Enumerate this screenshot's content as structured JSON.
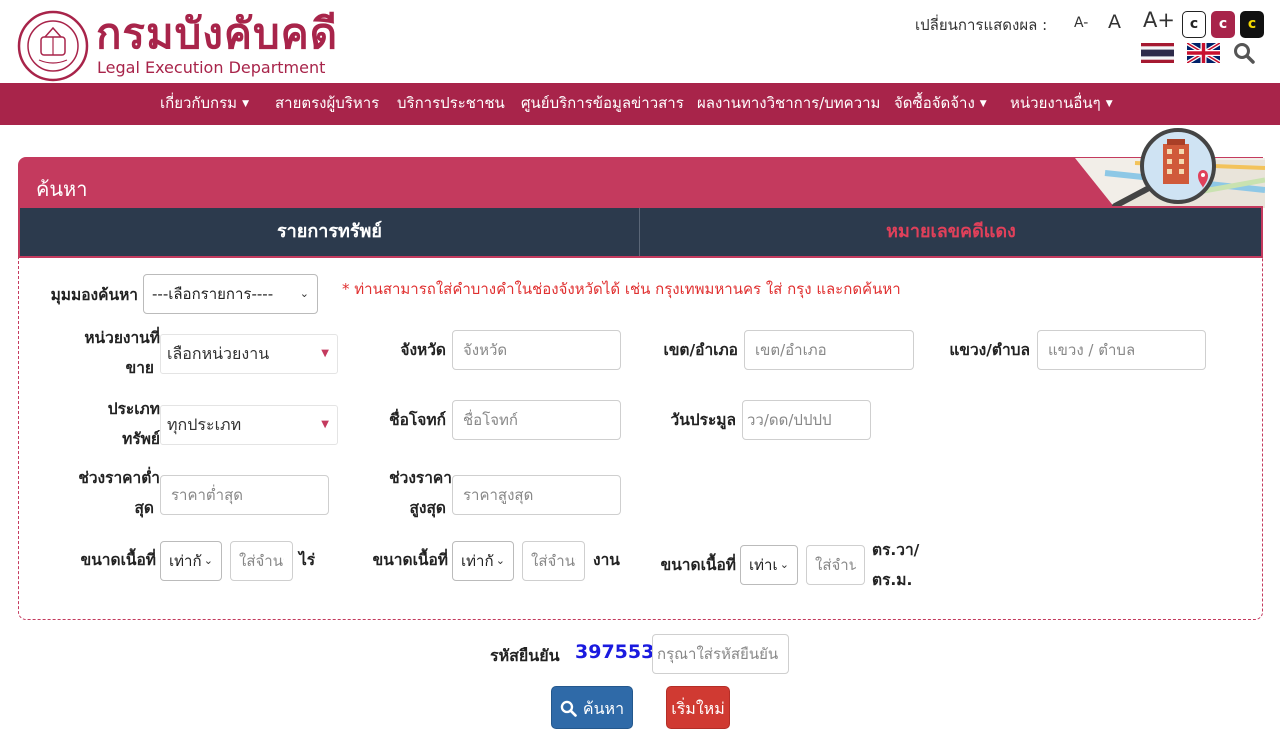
{
  "header": {
    "logo_th": "กรมบังคับคดี",
    "logo_en": "Legal Execution Department",
    "display_label": "เปลี่ยนการแสดงผล  :",
    "font_small": "A-",
    "font_normal": "A",
    "font_large": "A+",
    "contrast": [
      "c",
      "c",
      "c"
    ],
    "brand_color": "#a8244a"
  },
  "nav": {
    "items": [
      {
        "label": "เกี่ยวกับกรม",
        "dropdown": true
      },
      {
        "label": "สายตรงผู้บริหาร",
        "dropdown": false
      },
      {
        "label": "บริการประชาชน",
        "dropdown": false
      },
      {
        "label": "ศูนย์บริการข้อมูลข่าวสาร",
        "dropdown": false
      },
      {
        "label": "ผลงานทางวิชาการ/บทความ",
        "dropdown": false
      },
      {
        "label": "จัดซื้อจัดจ้าง",
        "dropdown": true
      },
      {
        "label": "หน่วยงานอื่นๆ",
        "dropdown": true
      }
    ]
  },
  "panel": {
    "title": "ค้นหา",
    "tabs": [
      "รายการทรัพย์",
      "หมายเลขคดีแดง"
    ]
  },
  "form": {
    "view_label": "มุมมองค้นหา",
    "view_value": "---เลือกรายการ----",
    "hint": "* ท่านสามารถใส่คำบางคำในช่องจังหวัดได้ เช่น กรุงเทพมหานคร ใส่ กรุง และกดค้นหา",
    "agency_label_1": "หน่วยงานที่",
    "agency_label_2": "ขาย",
    "agency_value": "เลือกหน่วยงาน",
    "province_label": "จังหวัด",
    "province_placeholder": "จังหวัด",
    "district_label": "เขต/อำเภอ",
    "district_placeholder": "เขต/อำเภอ",
    "subdistrict_label": "แขวง/ตำบล",
    "subdistrict_placeholder": "แขวง / ตำบล",
    "type_label_1": "ประเภท",
    "type_label_2": "ทรัพย์",
    "type_value": "ทุกประเภท",
    "plaintiff_label": "ชื่อโจทก์",
    "plaintiff_placeholder": "ชื่อโจทก์",
    "auction_date_label": "วันประมูล",
    "auction_date_placeholder": "วว/ดด/ปปปป",
    "price_min_label_1": "ช่วงราคาต่ำ",
    "price_min_label_2": "สุด",
    "price_min_placeholder": "ราคาต่ำสุด",
    "price_max_label_1": "ช่วงราคา",
    "price_max_label_2": "สูงสุด",
    "price_max_placeholder": "ราคาสูงสุด",
    "area_label": "ขนาดเนื้อที่",
    "area_cmp_value": "เท่ากั",
    "area_cmp_value_3": "เท่าเ",
    "area_placeholder": "ใส่จำนวน",
    "unit_rai": "ไร่",
    "unit_ngan": "งาน",
    "unit_wa_1": "ตร.วา/",
    "unit_wa_2": "ตร.ม."
  },
  "captcha": {
    "label": "รหัสยืนยัน",
    "code": "397553",
    "placeholder": "กรุณาใส่รหัสยืนยัน"
  },
  "buttons": {
    "search": "ค้นหา",
    "reset": "เริ่มใหม่"
  }
}
